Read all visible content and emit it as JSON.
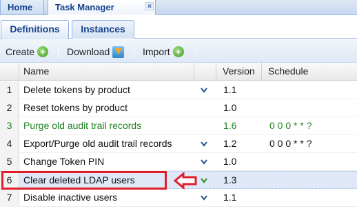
{
  "top_tabs": [
    {
      "label": "Home"
    },
    {
      "label": "Task Manager",
      "close": "✖"
    }
  ],
  "sub_tabs": [
    {
      "label": "Definitions"
    },
    {
      "label": "Instances"
    }
  ],
  "toolbar": {
    "create_label": "Create",
    "download_label": "Download",
    "import_label": "Import",
    "create_icon": "+",
    "import_icon": "+"
  },
  "grid": {
    "columns": {
      "name": "Name",
      "version": "Version",
      "schedule": "Schedule"
    },
    "rows": [
      {
        "num": "1",
        "name": "Delete tokens by product",
        "version": "1.1",
        "schedule": ""
      },
      {
        "num": "2",
        "name": "Reset tokens by product",
        "version": "1.0",
        "schedule": ""
      },
      {
        "num": "3",
        "name": "Purge old audit trail records",
        "version": "1.6",
        "schedule": "0 0 0 * * ?"
      },
      {
        "num": "4",
        "name": "Export/Purge old audit trail records",
        "version": "1.2",
        "schedule": "0 0 0 * * ?"
      },
      {
        "num": "5",
        "name": "Change Token PIN",
        "version": "1.0",
        "schedule": ""
      },
      {
        "num": "6",
        "name": "Clear deleted LDAP users",
        "version": "1.3",
        "schedule": ""
      },
      {
        "num": "7",
        "name": "Disable inactive users",
        "version": "1.1",
        "schedule": ""
      }
    ]
  },
  "colors": {
    "active_row_text": "#1e7f1e",
    "highlight": "#e01e2b",
    "chevron": "#2c5a99",
    "chevron_selected": "#2e8b2e"
  }
}
